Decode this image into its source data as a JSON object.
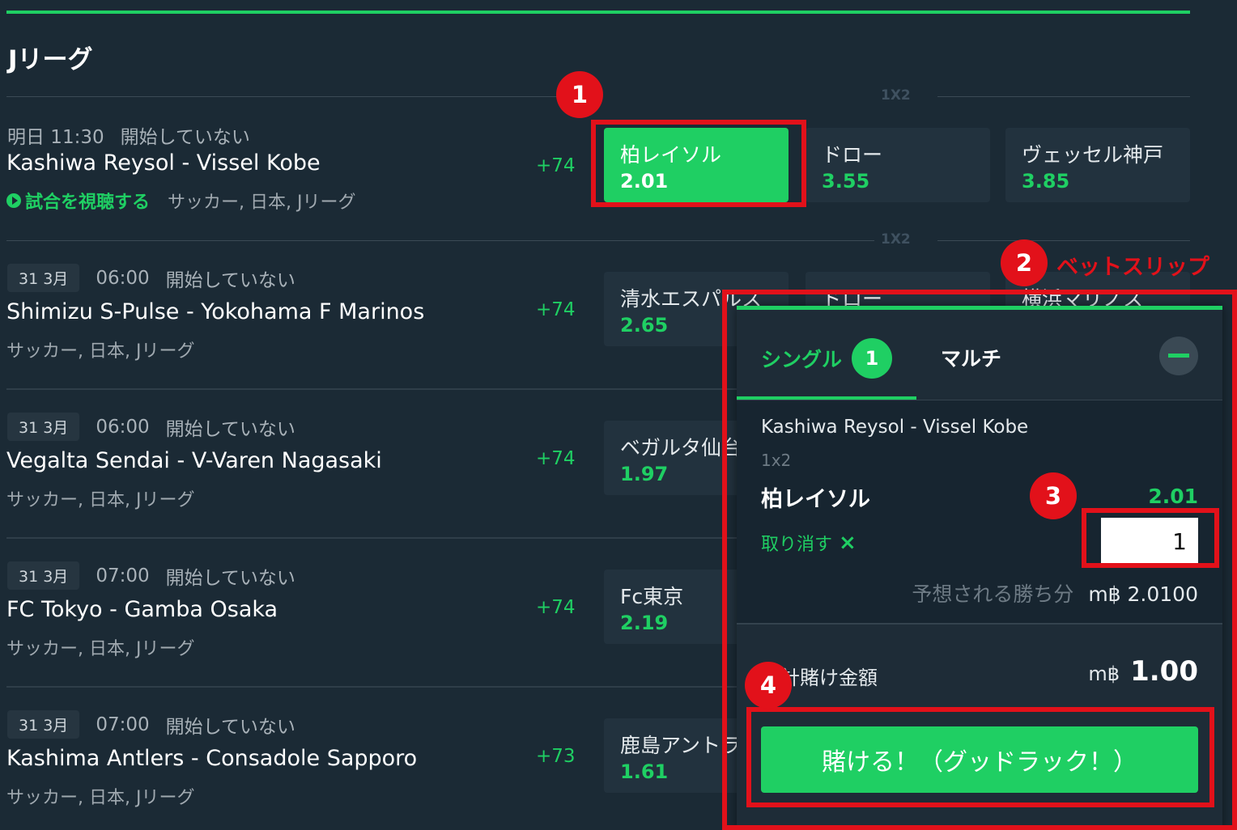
{
  "league": {
    "title": "Jリーグ"
  },
  "market_label": "1X2",
  "matches": [
    {
      "date": "明日 11:30",
      "status": "開始していない",
      "teams": "Kashiwa Reysol - Vissel Kobe",
      "watch_label": "試合を視聴する",
      "category": "サッカー, 日本, Jリーグ",
      "more_markets": "+74",
      "odds": [
        {
          "name": "柏レイソル",
          "price": "2.01"
        },
        {
          "name": "ドロー",
          "price": "3.55"
        },
        {
          "name": "ヴェッセル神戸",
          "price": "3.85"
        }
      ]
    },
    {
      "date": "31 3月",
      "time": "06:00",
      "status": "開始していない",
      "teams": "Shimizu S-Pulse - Yokohama F Marinos",
      "category": "サッカー, 日本, Jリーグ",
      "more_markets": "+74",
      "odds": [
        {
          "name": "清水エスパルス",
          "price": "2.65"
        },
        {
          "name": "ドロー",
          "price": ""
        },
        {
          "name": "横浜マリノス",
          "price": ""
        }
      ]
    },
    {
      "date": "31 3月",
      "time": "06:00",
      "status": "開始していない",
      "teams": "Vegalta Sendai - V-Varen Nagasaki",
      "category": "サッカー, 日本, Jリーグ",
      "more_markets": "+74",
      "odds": [
        {
          "name": "ベガルタ仙台",
          "price": "1.97"
        }
      ]
    },
    {
      "date": "31 3月",
      "time": "07:00",
      "status": "開始していない",
      "teams": "FC Tokyo - Gamba Osaka",
      "category": "サッカー, 日本, Jリーグ",
      "more_markets": "+74",
      "odds": [
        {
          "name": "Fc東京",
          "price": "2.19"
        }
      ]
    },
    {
      "date": "31 3月",
      "time": "07:00",
      "status": "開始していない",
      "teams": "Kashima Antlers - Consadole Sapporo",
      "category": "サッカー, 日本, Jリーグ",
      "more_markets": "+73",
      "odds": [
        {
          "name": "鹿島アントラーズ",
          "price": "1.61"
        }
      ]
    }
  ],
  "annotations": {
    "step1": "1",
    "step2": "2",
    "step3": "3",
    "step4": "4",
    "betslip_label": "ベットスリップ"
  },
  "betslip": {
    "tab_single": "シングル",
    "single_count": "1",
    "tab_multi": "マルチ",
    "match": "Kashiwa Reysol - Vissel Kobe",
    "market": "1x2",
    "selection": "柏レイソル",
    "odds": "2.01",
    "remove_label": "取り消す",
    "remove_icon": "×",
    "stake_value": "1",
    "expected_label": "予想される勝ち分",
    "expected_value": "m฿ 2.0100",
    "total_label": "合計賭け金額",
    "total_currency": "m฿",
    "total_value": "1.00",
    "place_bet_label": "賭ける！（グッドラック！）"
  },
  "colors": {
    "accent": "#1fcf63",
    "annotation": "#e2111a",
    "background": "#1b2a35"
  }
}
